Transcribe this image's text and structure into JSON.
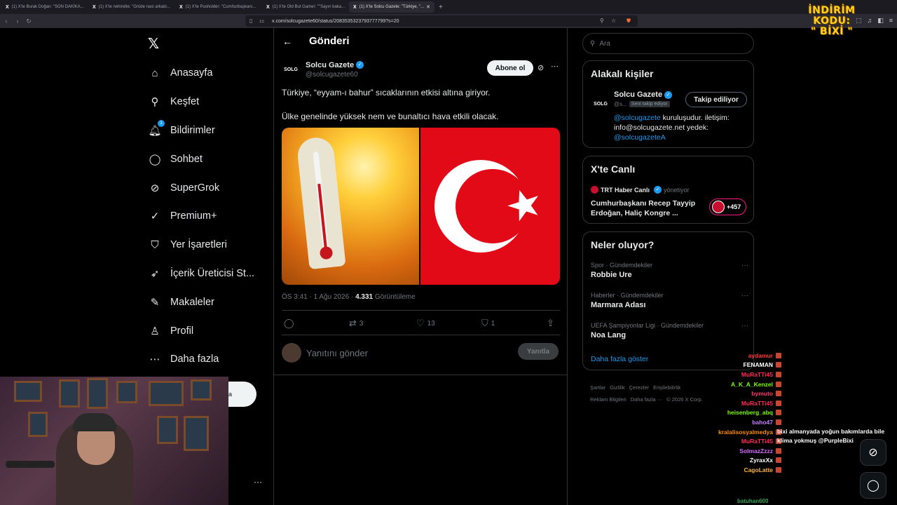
{
  "browser": {
    "tabs": [
      {
        "title": "(1) X'te Burak Doğan: \"SON DAKİKA..."
      },
      {
        "title": "(1) X'te nehirette: \"Grüde nasi arkadı..."
      },
      {
        "title": "(1) X'te Pusholder: \"Cumhurbaşkanı..."
      },
      {
        "title": "(1) X'te Old But Gamer: \"\"Sayın baka..."
      },
      {
        "title": "(1) X'te Solcu Gazete: \"Türkiye, \"..."
      }
    ],
    "url": "x.com/solcugazete60/status/2083535323793777799?s=20"
  },
  "promo": {
    "line1": "İNDİRİM KODU:",
    "line2": "\" BİXİ \""
  },
  "nav": {
    "items": [
      {
        "label": "Anasayfa",
        "icon": "home-icon",
        "glyph": "⌂"
      },
      {
        "label": "Keşfet",
        "icon": "search-icon",
        "glyph": "⚲"
      },
      {
        "label": "Bildirimler",
        "icon": "bell-icon",
        "glyph": "🔔︎",
        "badge": "1"
      },
      {
        "label": "Sohbet",
        "icon": "chat-icon",
        "glyph": "◯"
      },
      {
        "label": "SuperGrok",
        "icon": "grok-icon",
        "glyph": "⊘"
      },
      {
        "label": "Premium+",
        "icon": "verified-icon",
        "glyph": "✓"
      },
      {
        "label": "Yer İşaretleri",
        "icon": "bookmark-icon",
        "glyph": "⛉"
      },
      {
        "label": "İçerik Üreticisi St...",
        "icon": "rocket-icon",
        "glyph": "➶"
      },
      {
        "label": "Makaleler",
        "icon": "article-icon",
        "glyph": "✎"
      },
      {
        "label": "Profil",
        "icon": "user-icon",
        "glyph": "♙"
      },
      {
        "label": "Daha fazla",
        "icon": "more-circle-icon",
        "glyph": "⋯"
      }
    ],
    "post_label": "a"
  },
  "post": {
    "header": "Gönderi",
    "author_name": "Solcu Gazete",
    "author_handle": "@solcugazete60",
    "avatar_text": "SOLG",
    "subscribe_label": "Abone ol",
    "text1": "Türkiye, “eyyam-ı bahur” sıcaklarının etkisi altına giriyor.",
    "text2": "Ülke genelinde yüksek nem ve bunaltıcı hava etkili olacak.",
    "time": "ÖS 3:41 · 1 Ağu 2026 · ",
    "views": "4.331",
    "views_label": " Görüntüleme",
    "retweets": "3",
    "likes": "13",
    "bookmarks": "1",
    "reply_placeholder": "Yanıtını gönder",
    "reply_button": "Yanıtla"
  },
  "search": {
    "placeholder": "Ara"
  },
  "related": {
    "title": "Alakalı kişiler",
    "name": "Solcu Gazete",
    "handle": "@s...",
    "follows_you": "Seni takip ediyor",
    "follow_label": "Takip ediliyor",
    "avatar_text": "SOLG",
    "bio_link1": "@solcugazete",
    "bio_text": " kuruluşudur. iletişim: info@solcugazete.net yedek: ",
    "bio_link2": "@solcugazeteA"
  },
  "live": {
    "title": "X'te Canlı",
    "host": "TRT Haber Canlı",
    "role": "yönetiyor",
    "headline": "Cumhurbaşkanı Recep Tayyip Erdoğan, Haliç Kongre ...",
    "count": "+457"
  },
  "trends": {
    "title": "Neler oluyor?",
    "items": [
      {
        "category": "Spor · Gündemdekiler",
        "name": "Robbie Ure"
      },
      {
        "category": "Haberler · Gündemdekiler",
        "name": "Marmara Adası"
      },
      {
        "category": "UEFA Şampiyonlar Ligi · Gündemdekiler",
        "name": "Noa Lang"
      }
    ],
    "show_more": "Daha fazla göster"
  },
  "footer": {
    "links": [
      "Şartlar",
      "Gizlilik",
      "Çerezler",
      "Erişilebilirlik",
      "Reklam Bilgileri",
      "Daha fazla ···",
      "© 2026 X Corp."
    ]
  },
  "chat": {
    "rows": [
      {
        "user": "aydamur",
        "color": "#ff3b3b"
      },
      {
        "user": "FENAMAN",
        "color": "#ffffff"
      },
      {
        "user": "MuRaTTi45",
        "color": "#ff2d55"
      },
      {
        "user": "A_K_A_Kenzel",
        "color": "#7cfc00"
      },
      {
        "user": "bymuto",
        "color": "#ff3b6b"
      },
      {
        "user": "MuRaTTi45",
        "color": "#ff2d55"
      },
      {
        "user": "heisenberg_abq",
        "color": "#7cfc00"
      },
      {
        "user": "baho47",
        "color": "#c77dff"
      },
      {
        "user": "kralalisosyalmedya",
        "color": "#ff8c00"
      },
      {
        "user": "MuRaTTi45",
        "color": "#ff2d55"
      },
      {
        "user": "SolmazZzzz",
        "color": "#d56bff"
      },
      {
        "user": "ZyraxXx",
        "color": "#ffffff"
      },
      {
        "user": "CagoLatte",
        "color": "#ffb347"
      }
    ],
    "message": "bixi almanyada yoğun bakımlarda bile klima yokmuş @PurpleBixi",
    "bottom_user": "batuhan600"
  },
  "colors": {
    "accent": "#1d9bf0",
    "background": "#000000",
    "flag_red": "#e30a17"
  }
}
